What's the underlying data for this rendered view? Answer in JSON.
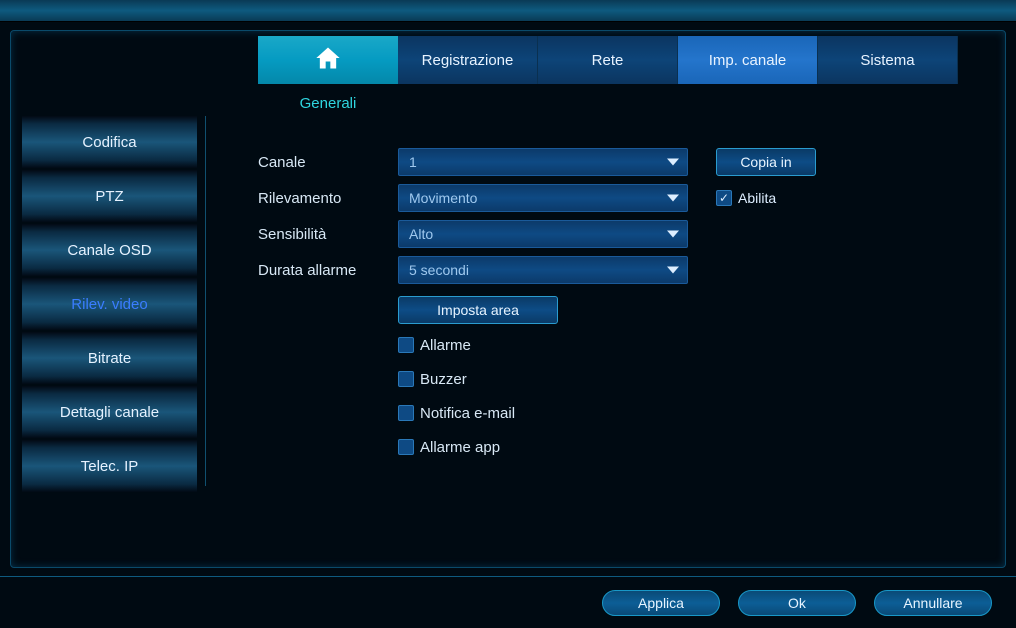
{
  "tabs": {
    "home_icon": "home",
    "registrazione": "Registrazione",
    "rete": "Rete",
    "imp_canale": "Imp. canale",
    "sistema": "Sistema"
  },
  "subtab": {
    "generali": "Generali"
  },
  "sidebar": {
    "items": [
      {
        "label": "Codifica"
      },
      {
        "label": "PTZ"
      },
      {
        "label": "Canale OSD"
      },
      {
        "label": "Rilev. video"
      },
      {
        "label": "Bitrate"
      },
      {
        "label": "Dettagli canale"
      },
      {
        "label": "Telec. IP"
      }
    ]
  },
  "form": {
    "canale_label": "Canale",
    "canale_value": "1",
    "rilevamento_label": "Rilevamento",
    "rilevamento_value": "Movimento",
    "sensibilita_label": "Sensibilità",
    "sensibilita_value": "Alto",
    "durata_label": "Durata allarme",
    "durata_value": "5 secondi",
    "copia_in": "Copia in",
    "abilita": "Abilita",
    "imposta_area": "Imposta area",
    "allarme": "Allarme",
    "buzzer": "Buzzer",
    "notifica_email": "Notifica e-mail",
    "allarme_app": "Allarme app"
  },
  "footer": {
    "applica": "Applica",
    "ok": "Ok",
    "annullare": "Annullare"
  }
}
